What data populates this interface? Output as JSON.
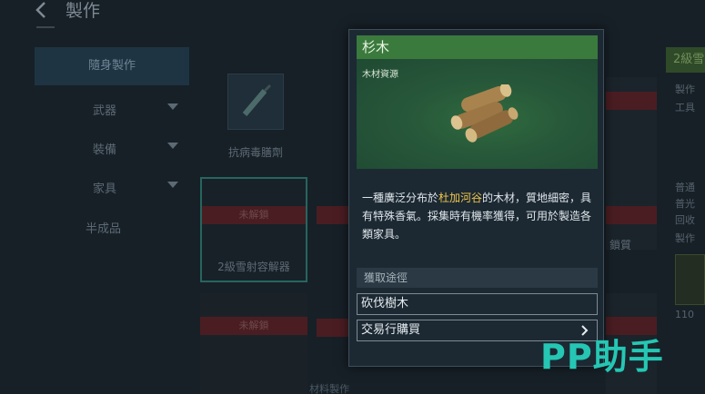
{
  "header": {
    "title": "製作",
    "back_icon": "back-arrow-icon"
  },
  "sidebar": {
    "main_label": "隨身製作",
    "items": [
      {
        "label": "武器",
        "has_caret": true
      },
      {
        "label": "裝備",
        "has_caret": true
      },
      {
        "label": "家具",
        "has_caret": true
      },
      {
        "label": "半成品",
        "has_caret": false
      }
    ]
  },
  "grid": {
    "cards": [
      {
        "name": "抗病毒膳劑"
      },
      {
        "name": "2級雪射容解器",
        "locked_label": "未解鎖"
      },
      {
        "name": "",
        "locked_label": "未解鎖"
      }
    ],
    "partial_name_right": "鎖質"
  },
  "right_panel": {
    "header": "2級雪",
    "lines": [
      "製作",
      "工具",
      "普通",
      "普光",
      "回收",
      "製作"
    ],
    "count": "110"
  },
  "bottom": {
    "label": "材料製作"
  },
  "popup": {
    "title": "杉木",
    "subtitle": "木材資源",
    "image_icon": "wood-logs-icon",
    "desc_before": "一種廣泛分布於",
    "desc_highlight": "杜加河谷",
    "desc_after": "的木材，質地細密，具有特殊香氣。採集時有機率獲得，可用於製造各類家具。",
    "acquire_header": "獲取途徑",
    "acquire_ways": [
      {
        "label": "砍伐樹木",
        "has_arrow": false
      },
      {
        "label": "交易行購買",
        "has_arrow": true
      }
    ]
  },
  "watermark": {
    "text": "PP助手"
  },
  "colors": {
    "title_green": "#3b7a3d",
    "highlight_yellow": "#f0c64b",
    "watermark_teal": "#25c7b4"
  }
}
